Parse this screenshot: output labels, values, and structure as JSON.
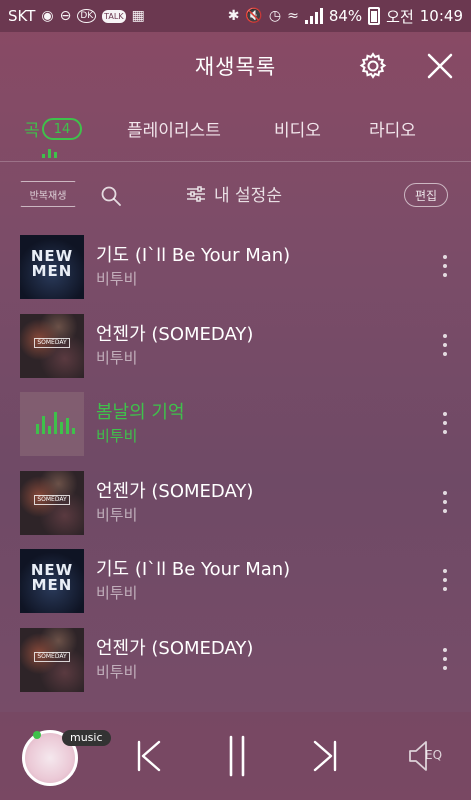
{
  "status": {
    "carrier": "SKT",
    "battery": "84%",
    "time_prefix": "오전",
    "time": "10:49",
    "dk_badge": "DK",
    "talk_badge": "TALK"
  },
  "header": {
    "title": "재생목록"
  },
  "tabs": [
    {
      "label": "곡",
      "count": "14",
      "active": true
    },
    {
      "label": "플레이리스트"
    },
    {
      "label": "비디오"
    },
    {
      "label": "라디오"
    }
  ],
  "toolbar": {
    "repeat_label": "반복재생",
    "sort_label": "내 설정순",
    "edit_label": "편집"
  },
  "songs": [
    {
      "title": "기도 (I`ll Be Your Man)",
      "artist": "비투비",
      "art": "newmen",
      "art_text": "NEW MEN"
    },
    {
      "title": "언젠가 (SOMEDAY)",
      "artist": "비투비",
      "art": "someday",
      "art_text": "SOMEDAY"
    },
    {
      "title": "봄날의 기억",
      "artist": "비투비",
      "art": "playing",
      "active": true
    },
    {
      "title": "언젠가 (SOMEDAY)",
      "artist": "비투비",
      "art": "someday",
      "art_text": "SOMEDAY"
    },
    {
      "title": "기도 (I`ll Be Your Man)",
      "artist": "비투비",
      "art": "newmen",
      "art_text": "NEW MEN"
    },
    {
      "title": "언젠가 (SOMEDAY)",
      "artist": "비투비",
      "art": "someday",
      "art_text": "SOMEDAY"
    }
  ],
  "player": {
    "badge": "music",
    "eq_label": "EQ"
  },
  "colors": {
    "accent": "#3fc14b",
    "background": "#7c4c68"
  },
  "icons": [
    "settings-gear-icon",
    "close-icon",
    "search-icon",
    "sort-sliders-icon",
    "more-vert-icon",
    "previous-icon",
    "pause-icon",
    "next-icon",
    "eq-icon"
  ]
}
